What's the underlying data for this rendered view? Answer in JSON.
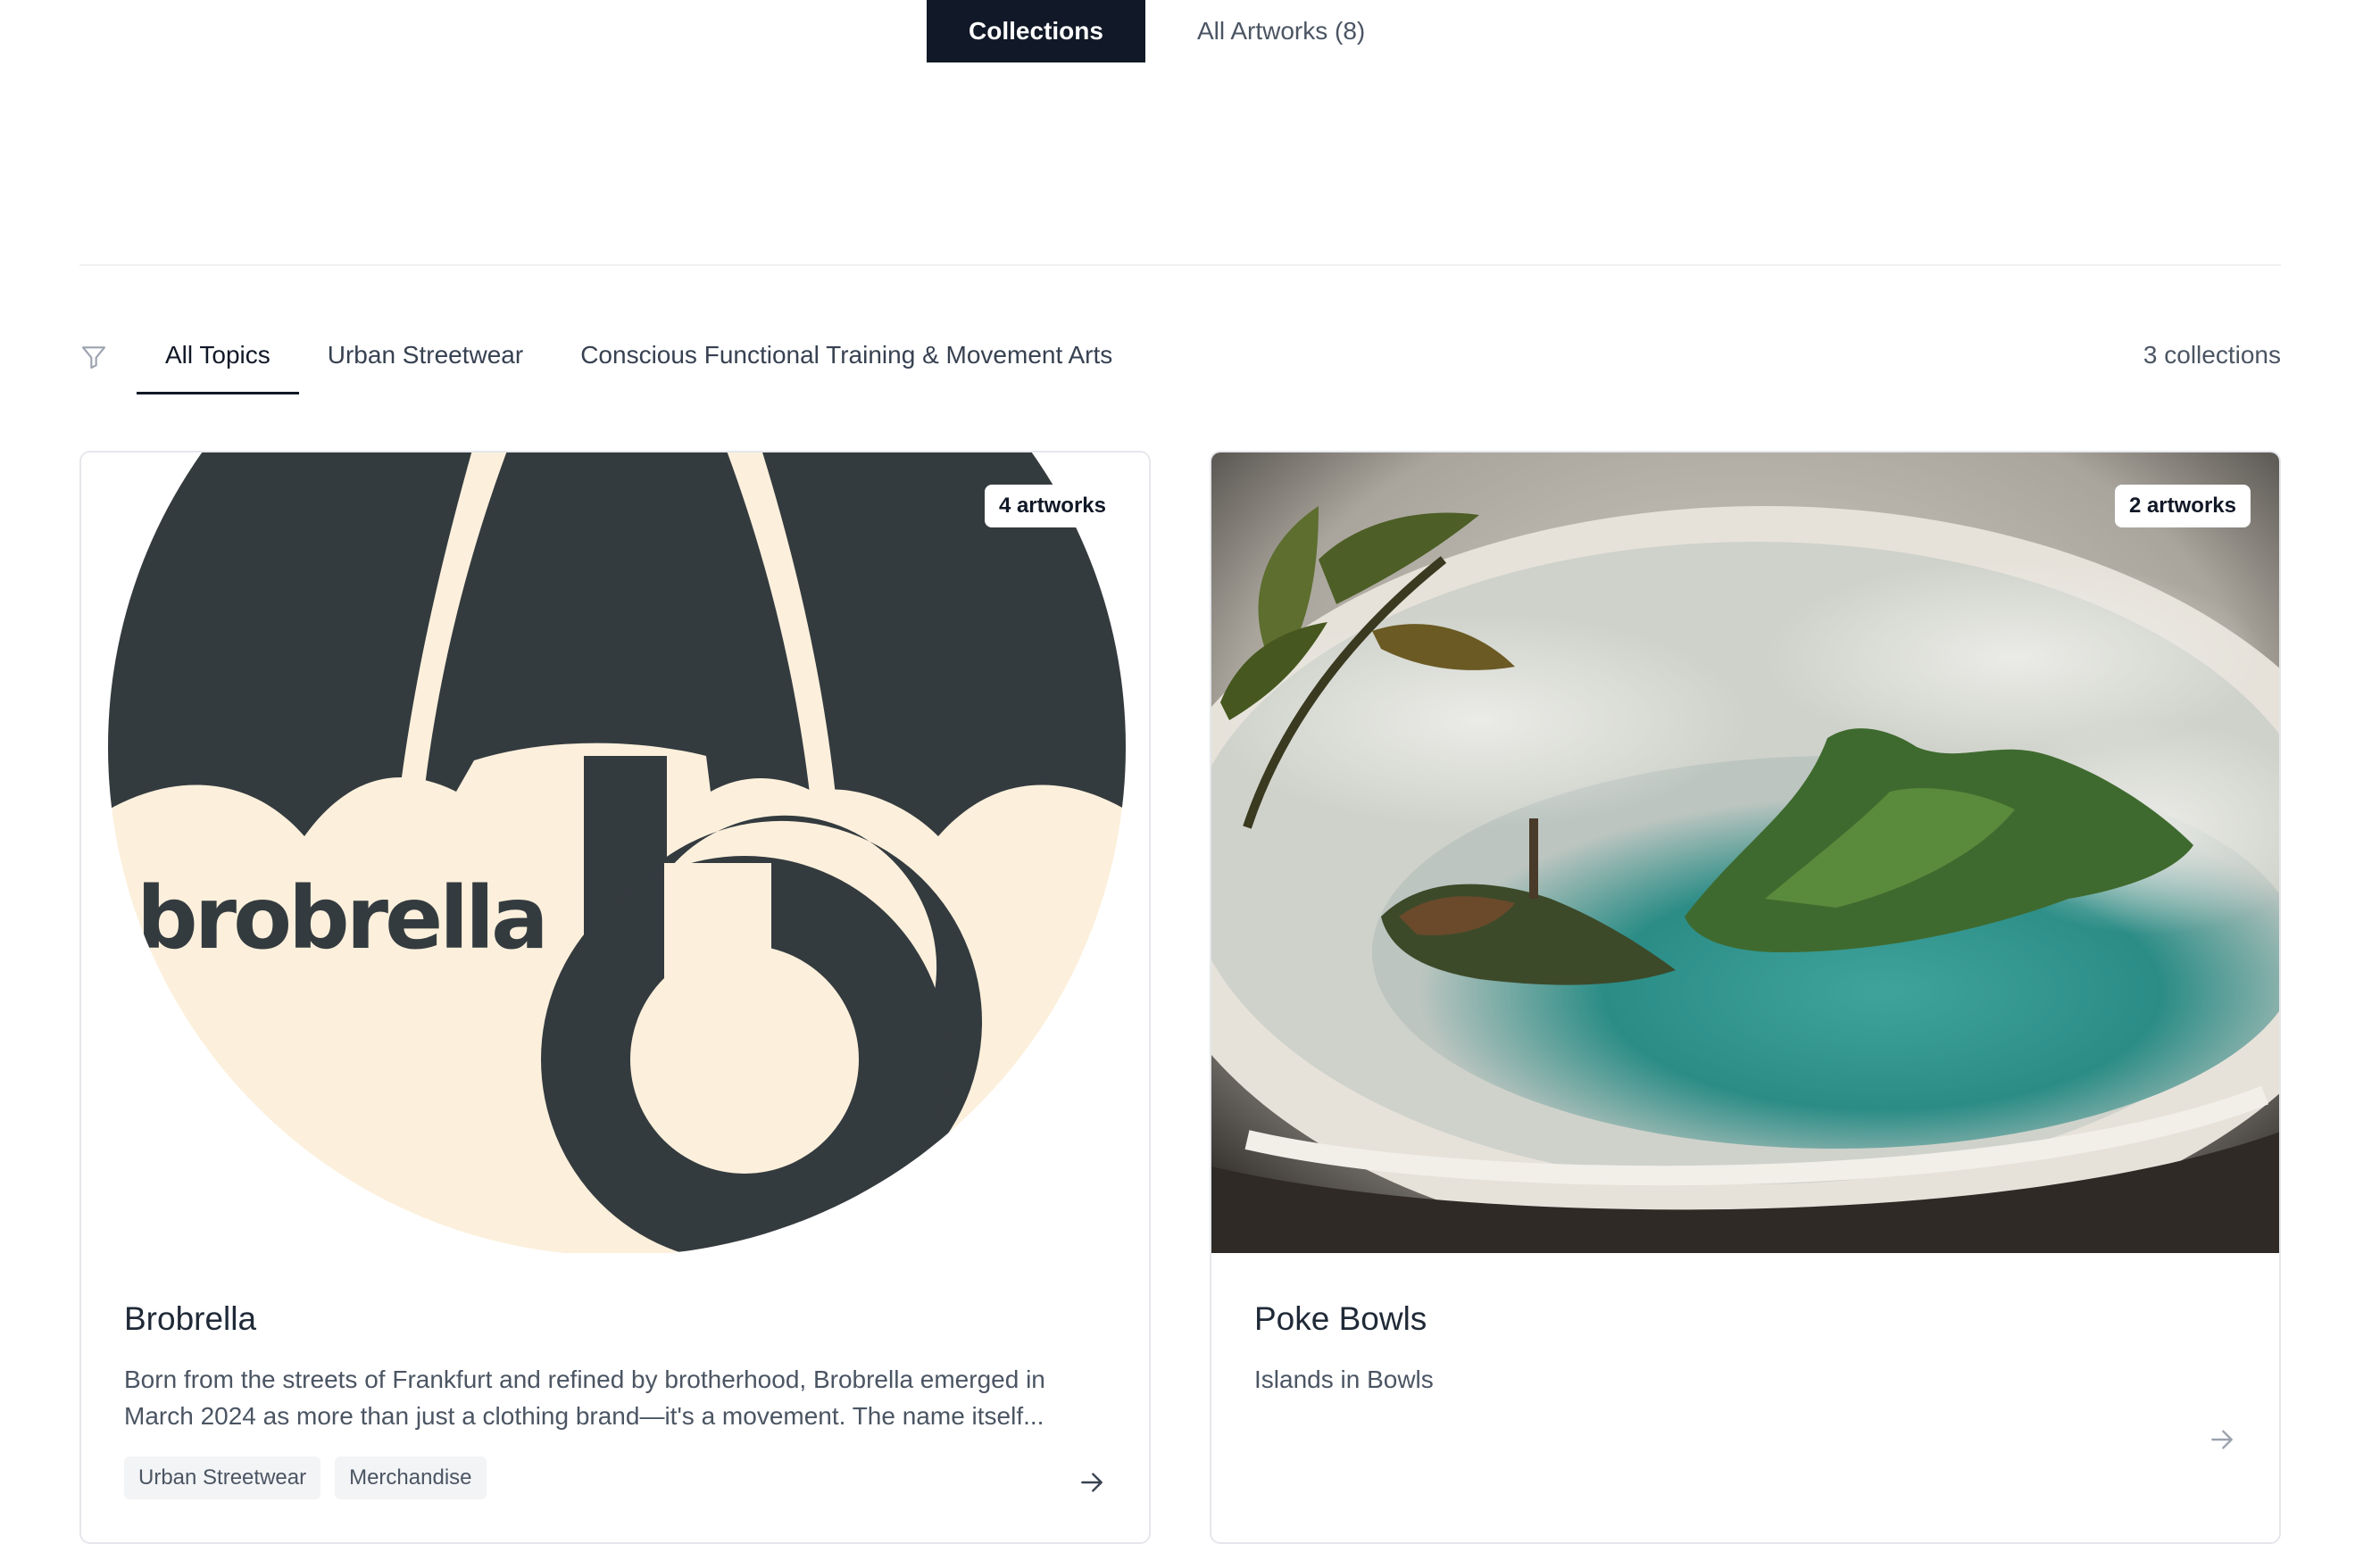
{
  "view_tabs": [
    {
      "label": "Collections",
      "active": true
    },
    {
      "label": "All Artworks (8)",
      "active": false
    }
  ],
  "filters": {
    "topics": [
      {
        "label": "All Topics",
        "active": true
      },
      {
        "label": "Urban Streetwear",
        "active": false
      },
      {
        "label": "Conscious Functional Training & Movement Arts",
        "active": false
      }
    ],
    "count_label": "3 collections"
  },
  "cards": [
    {
      "title": "Brobrella",
      "badge": "4 artworks",
      "description": "Born from the streets of Frankfurt and refined by brotherhood, Brobrella emerged in March 2024 as more than just a clothing brand—it's a movement. The name itself...",
      "tags": [
        "Urban Streetwear",
        "Merchandise"
      ],
      "logo_text": "brobrella",
      "colors": {
        "dark": "#343b3f",
        "cream": "#fcf0dc"
      }
    },
    {
      "title": "Poke Bowls",
      "badge": "2 artworks",
      "description": "Islands in Bowls",
      "tags": []
    }
  ],
  "icons": {
    "filter": "filter-icon",
    "arrow": "arrow-right-icon"
  }
}
